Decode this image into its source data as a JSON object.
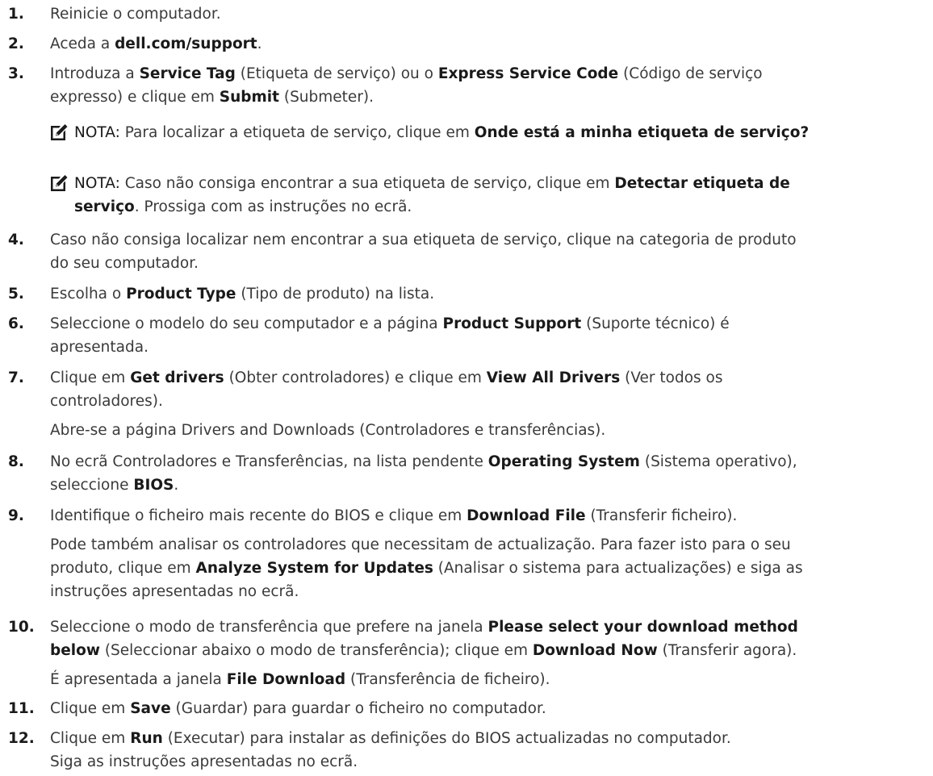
{
  "steps": [
    {
      "num": "1.",
      "lines": [
        [
          {
            "t": "Reinicie o computador."
          }
        ]
      ]
    },
    {
      "num": "2.",
      "lines": [
        [
          {
            "t": "Aceda a "
          },
          {
            "t": "dell.com/support",
            "b": true
          },
          {
            "t": "."
          }
        ]
      ]
    },
    {
      "num": "3.",
      "lines": [
        [
          {
            "t": "Introduza a "
          },
          {
            "t": "Service Tag",
            "b": true
          },
          {
            "t": " (Etiqueta de serviço) ou o "
          },
          {
            "t": "Express Service Code",
            "b": true
          },
          {
            "t": " (Código de serviço"
          }
        ],
        [
          {
            "t": "expresso) e clique em "
          },
          {
            "t": "Submit",
            "b": true
          },
          {
            "t": " (Submeter)."
          }
        ]
      ]
    },
    {
      "num": "4.",
      "lines": [
        [
          {
            "t": "Caso não consiga localizar nem encontrar a sua etiqueta de serviço, clique na categoria de produto"
          }
        ],
        [
          {
            "t": "do seu computador."
          }
        ]
      ]
    },
    {
      "num": "5.",
      "lines": [
        [
          {
            "t": "Escolha o "
          },
          {
            "t": "Product Type",
            "b": true
          },
          {
            "t": " (Tipo de produto) na lista."
          }
        ]
      ]
    },
    {
      "num": "6.",
      "lines": [
        [
          {
            "t": "Seleccione o modelo do seu computador e a página "
          },
          {
            "t": "Product Support",
            "b": true
          },
          {
            "t": " (Suporte técnico) é"
          }
        ],
        [
          {
            "t": "apresentada."
          }
        ]
      ]
    },
    {
      "num": "7.",
      "lines": [
        [
          {
            "t": "Clique em "
          },
          {
            "t": "Get drivers",
            "b": true
          },
          {
            "t": " (Obter controladores) e clique em "
          },
          {
            "t": "View All Drivers",
            "b": true
          },
          {
            "t": " (Ver todos os"
          }
        ],
        [
          {
            "t": "controladores)."
          }
        ]
      ],
      "sub": [
        [
          {
            "t": "Abre-se a página Drivers and Downloads (Controladores e transferências)."
          }
        ]
      ]
    },
    {
      "num": "8.",
      "lines": [
        [
          {
            "t": "No ecrã Controladores e Transferências, na lista pendente "
          },
          {
            "t": "Operating System",
            "b": true
          },
          {
            "t": " (Sistema operativo),"
          }
        ],
        [
          {
            "t": "seleccione "
          },
          {
            "t": "BIOS",
            "b": true
          },
          {
            "t": "."
          }
        ]
      ]
    },
    {
      "num": "9.",
      "lines": [
        [
          {
            "t": "Identifique o ficheiro mais recente do BIOS e clique em "
          },
          {
            "t": "Download File",
            "b": true
          },
          {
            "t": " (Transferir ficheiro)."
          }
        ]
      ],
      "sub": [
        [
          {
            "t": "Pode também analisar os controladores que necessitam de actualização. Para fazer isto para o seu"
          }
        ],
        [
          {
            "t": "produto, clique em "
          },
          {
            "t": "Analyze System for Updates",
            "b": true
          },
          {
            "t": " (Analisar o sistema para actualizações) e siga as"
          }
        ],
        [
          {
            "t": "instruções apresentadas no ecrã."
          }
        ]
      ]
    },
    {
      "num": "10.",
      "lines": [
        [
          {
            "t": "Seleccione o modo de transferência que prefere na janela "
          },
          {
            "t": "Please select your download method",
            "b": true
          }
        ],
        [
          {
            "t": "below",
            "b": true
          },
          {
            "t": " (Seleccionar abaixo o modo de transferência); clique em "
          },
          {
            "t": "Download Now",
            "b": true
          },
          {
            "t": " (Transferir agora)."
          }
        ]
      ],
      "sub": [
        [
          {
            "t": "É apresentada a janela "
          },
          {
            "t": "File Download",
            "b": true
          },
          {
            "t": " (Transferência de ficheiro)."
          }
        ]
      ]
    },
    {
      "num": "11.",
      "lines": [
        [
          {
            "t": "Clique em "
          },
          {
            "t": "Save",
            "b": true
          },
          {
            "t": " (Guardar) para guardar o ficheiro no computador."
          }
        ]
      ]
    },
    {
      "num": "12.",
      "lines": [
        [
          {
            "t": "Clique em "
          },
          {
            "t": "Run",
            "b": true
          },
          {
            "t": " (Executar) para instalar as definições do BIOS actualizadas no computador."
          }
        ]
      ],
      "sub": [
        [
          {
            "t": "Siga as instruções apresentadas no ecrã."
          }
        ]
      ]
    }
  ],
  "notes": [
    {
      "label": "NOTA:",
      "lines": [
        [
          {
            "t": " Para localizar a etiqueta de serviço, clique em "
          },
          {
            "t": "Onde está a minha etiqueta de serviço?",
            "b": true
          }
        ]
      ]
    },
    {
      "label": "NOTA:",
      "lines": [
        [
          {
            "t": " Caso não consiga encontrar a sua etiqueta de serviço, clique em "
          },
          {
            "t": "Detectar etiqueta de",
            "b": true
          }
        ],
        [
          {
            "t": "serviço",
            "b": true
          },
          {
            "t": ". Prossiga com as instruções no ecrã."
          }
        ]
      ]
    }
  ],
  "colors": {
    "text": "#3a3a3a",
    "bold": "#1a1a1a",
    "note_icon": "#1a1a1a"
  },
  "icons": {
    "note": "pencil-note-icon"
  }
}
